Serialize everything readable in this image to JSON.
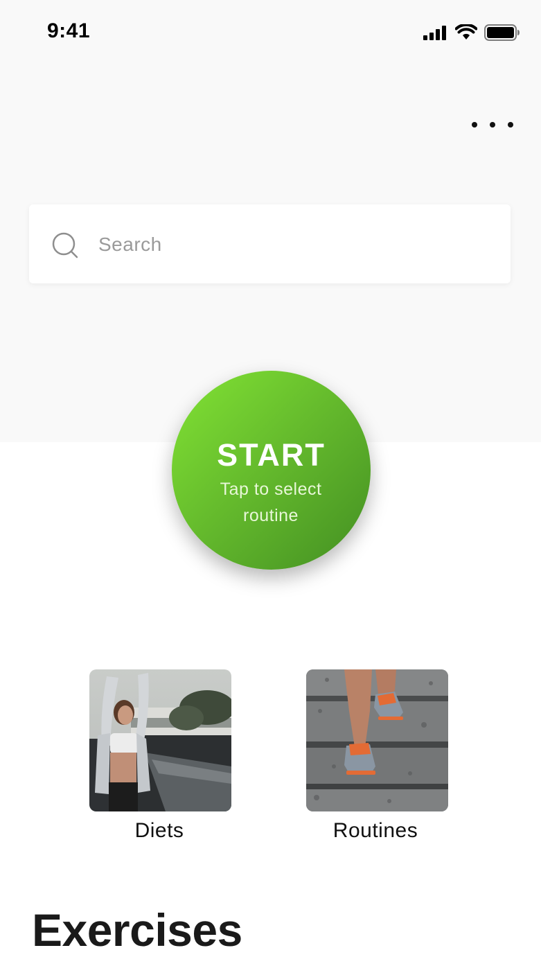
{
  "status_bar": {
    "time": "9:41",
    "icons": [
      "signal-icon",
      "wifi-icon",
      "battery-icon"
    ]
  },
  "header": {
    "more_icon": "more-horizontal-icon"
  },
  "search": {
    "placeholder": "Search",
    "value": "",
    "icon": "search-icon"
  },
  "start": {
    "title": "START",
    "subtitle": "Tap to select routine",
    "colors": [
      "#82e334",
      "#438f22"
    ]
  },
  "categories": [
    {
      "label": "Diets",
      "image": "woman-stretching-photo"
    },
    {
      "label": "Routines",
      "image": "running-shoes-stairs-photo"
    }
  ],
  "sections": {
    "exercises_title": "Exercises"
  }
}
